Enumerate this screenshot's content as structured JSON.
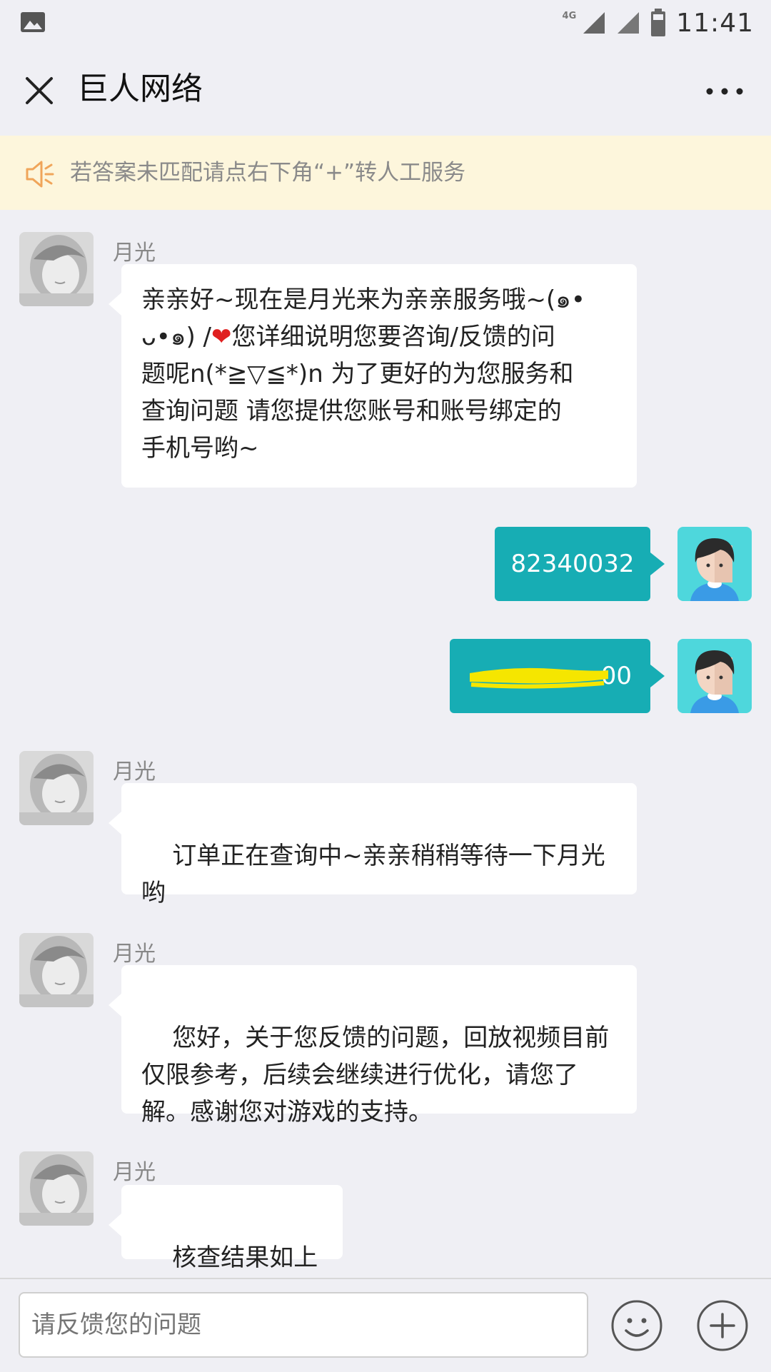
{
  "status_bar": {
    "network": "4G",
    "time": "11:41"
  },
  "header": {
    "title": "巨人网络"
  },
  "notice": {
    "text": "若答案未匹配请点右下角“+”转人工服务"
  },
  "messages": [
    {
      "from": "agent",
      "sender": "月光",
      "text": "亲亲好~现在是月光来为亲亲服务哦~(๑•ᴗ•๑) /❤您详细说明您要咨询/反馈的问题呢n(*≧▽≦*)n 为了更好的为您服务和查询问题 请您提供您账号和账号绑定的手机号哟~",
      "text_before_heart": "亲亲好~现在是月光来为亲亲服务哦~(๑•\nᴗ•๑) /",
      "heart": "❤",
      "text_after_heart": "您详细说明您要咨询/反馈的问\n题呢n(*≧▽≦*)n 为了更好的为您服务和\n查询问题 请您提供您账号和账号绑定的\n手机号哟~"
    },
    {
      "from": "user",
      "text": "82340032"
    },
    {
      "from": "user",
      "text": "00",
      "redacted": true
    },
    {
      "from": "agent",
      "sender": "月光",
      "text": "订单正在查询中~亲亲稍稍等待一下月光\n哟"
    },
    {
      "from": "agent",
      "sender": "月光",
      "text": "您好，关于您反馈的问题，回放视频目前\n仅限参考，后续会继续进行优化，请您了\n解。感谢您对游戏的支持。"
    },
    {
      "from": "agent",
      "sender": "月光",
      "text": "核查结果如上哦"
    }
  ],
  "input_bar": {
    "placeholder": "请反馈您的问题"
  },
  "icons": {
    "close": "close-icon",
    "more": "more-icon",
    "notice": "speaker-icon",
    "emoji": "smile-icon",
    "plus": "plus-icon"
  },
  "colors": {
    "background": "#efeff4",
    "notice_bg": "#fdf6dc",
    "user_bubble": "#17adb4",
    "agent_bubble": "#ffffff",
    "redaction": "#f5e600"
  }
}
